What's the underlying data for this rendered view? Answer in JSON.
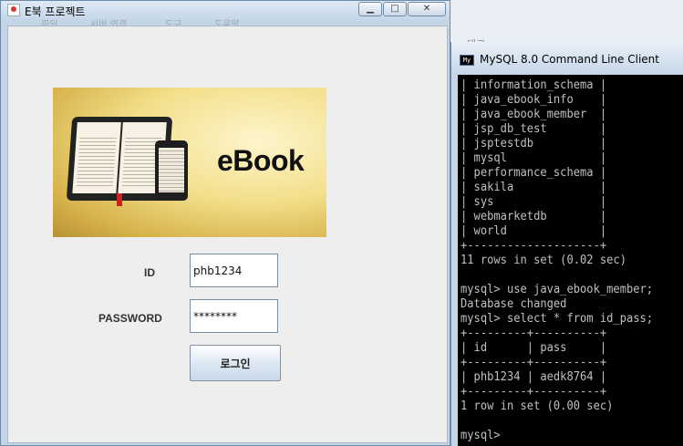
{
  "background": {
    "tab_text": "대그"
  },
  "java_window": {
    "title": "E북 프로젝트",
    "ghost_menu": [
      "파일",
      "서버 연결",
      "도구",
      "도움말"
    ],
    "min_glyph": "▁",
    "max_glyph": "□",
    "close_glyph": "✕",
    "banner_text": "eBook",
    "id_label": "ID",
    "id_value": "phb1234",
    "password_label": "PASSWORD",
    "password_value": "********",
    "login_button": "로그인"
  },
  "mysql_window": {
    "icon_text": "My",
    "title": "MySQL 8.0 Command Line Client",
    "lines": [
      "| information_schema |",
      "| java_ebook_info    |",
      "| java_ebook_member  |",
      "| jsp_db_test        |",
      "| jsptestdb          |",
      "| mysql              |",
      "| performance_schema |",
      "| sakila             |",
      "| sys                |",
      "| webmarketdb        |",
      "| world              |",
      "+--------------------+",
      "11 rows in set (0.02 sec)",
      "",
      "mysql> use java_ebook_member;",
      "Database changed",
      "mysql> select * from id_pass;",
      "+---------+----------+",
      "| id      | pass     |",
      "+---------+----------+",
      "| phb1234 | aedk8764 |",
      "+---------+----------+",
      "1 row in set (0.00 sec)",
      "",
      "mysql>"
    ]
  }
}
